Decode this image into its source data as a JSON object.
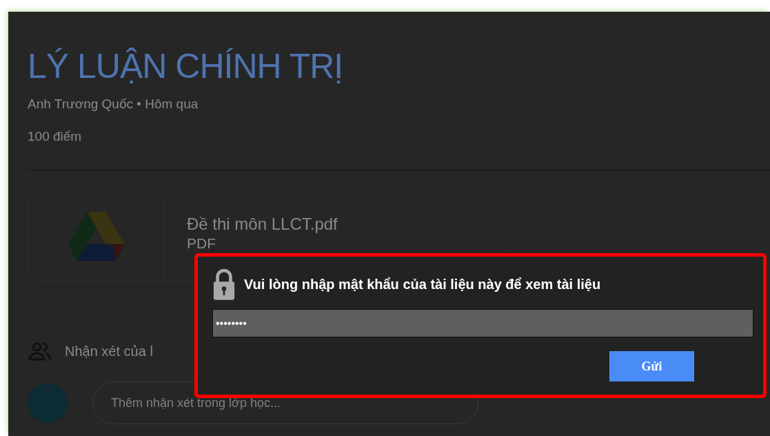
{
  "assignment": {
    "title": "LÝ LUẬN CHÍNH TRỊ",
    "meta": "Anh Trương Quốc • Hôm qua",
    "points": "100 điểm"
  },
  "attachment": {
    "name": "Đề thi môn LLCT.pdf",
    "type": "PDF"
  },
  "comments": {
    "label": "Nhận xét của l",
    "placeholder": "Thêm nhận xét trong lớp học..."
  },
  "dialog": {
    "message": "Vui lòng nhập mật khẩu của tài liệu này để xem tài liệu",
    "password": "••••••••",
    "submit": "Gửi"
  }
}
